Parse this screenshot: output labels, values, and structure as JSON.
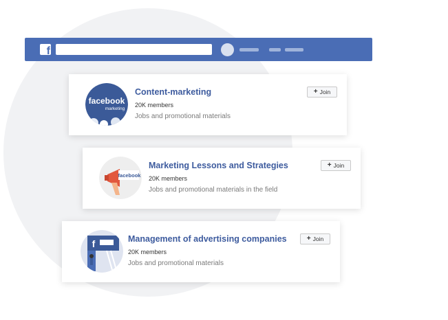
{
  "topbar": {
    "logo_letter": "f",
    "search_value": ""
  },
  "groups": [
    {
      "name": "Content-marketing",
      "members": "20K members",
      "description": "Jobs and promotional materials",
      "join_label": "Join",
      "thumb_text": "facebook",
      "thumb_subtext": "marketing"
    },
    {
      "name": "Marketing Lessons and Strategies",
      "members": "20K members",
      "description": "Jobs and promotional materials in the field",
      "join_label": "Join",
      "thumb_text": "facebook"
    },
    {
      "name": "Management of advertising companies",
      "members": "20K members",
      "description": "Jobs and promotional materials",
      "join_label": "Join",
      "thumb_text": "f"
    }
  ],
  "icons": {
    "join": "plus-icon",
    "logo": "facebook-logo-icon"
  },
  "colors": {
    "brand": "#4a6db5",
    "title": "#3d5b9e",
    "megaphone": "#e2583e"
  }
}
